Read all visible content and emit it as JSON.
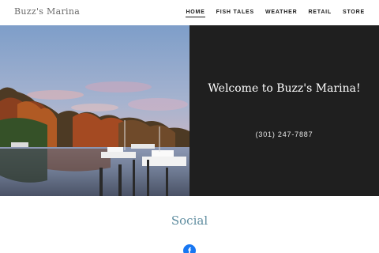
{
  "site": {
    "logo": "Buzz's Marina"
  },
  "nav": {
    "items": [
      {
        "label": "HOME",
        "active": true
      },
      {
        "label": "FISH TALES"
      },
      {
        "label": "WEATHER"
      },
      {
        "label": "RETAIL"
      },
      {
        "label": "STORE"
      }
    ]
  },
  "hero": {
    "heading": "Welcome to Buzz's Marina!",
    "phone": "(301) 247-7887",
    "panel_color": "#1f1f1f"
  },
  "social": {
    "title": "Social",
    "icon": "facebook-icon",
    "icon_glyph": "f",
    "color": "#5f8da0",
    "facebook_color": "#1877f2"
  }
}
